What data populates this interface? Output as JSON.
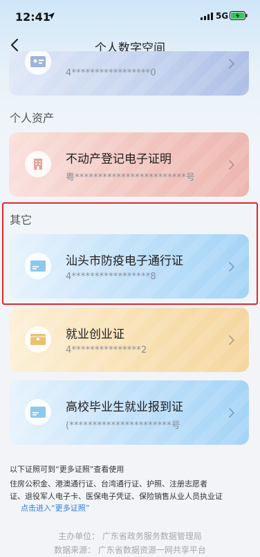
{
  "status_bar": {
    "time": "12:41",
    "network": "5G",
    "battery_color": "#34c759"
  },
  "nav": {
    "title": "个人数字空间",
    "back_icon": "chevron-left-icon"
  },
  "cards_top": [
    {
      "title": "",
      "number": "4*****************0",
      "icon": "id-card-icon"
    }
  ],
  "sections": {
    "assets_label": "个人资产",
    "other_label": "其它"
  },
  "cards": {
    "property": {
      "title": "不动产登记电子证明",
      "number": "粤************************号",
      "icon": "building-icon",
      "color": "#f2c2bc"
    },
    "epidemic_pass": {
      "title": "汕头市防疫电子通行证",
      "number": "4*****************8",
      "icon": "card-icon",
      "color": "#a9d8f8"
    },
    "employment": {
      "title": "就业创业证",
      "number": "4***************2",
      "icon": "wallet-icon",
      "color": "#f7dfb0"
    },
    "graduate": {
      "title": "高校毕业生就业报到证",
      "number": "(**********************号",
      "icon": "card-icon",
      "color": "#a9d8f8"
    }
  },
  "footer": {
    "line1": "以下证照可到“更多证照”查看使用",
    "line2": "住房公积金、港澳通行证、台湾通行证、护照、注册志愿者",
    "line3": "证、退役军人电子卡、医保电子凭证、保险销售从业人员执业证",
    "more_link": "点击进入“更多证照”",
    "organizer": "主办单位：  广东省政务服务数据管理局",
    "source": "数据来源：  广东省数据资源一网共享平台"
  }
}
